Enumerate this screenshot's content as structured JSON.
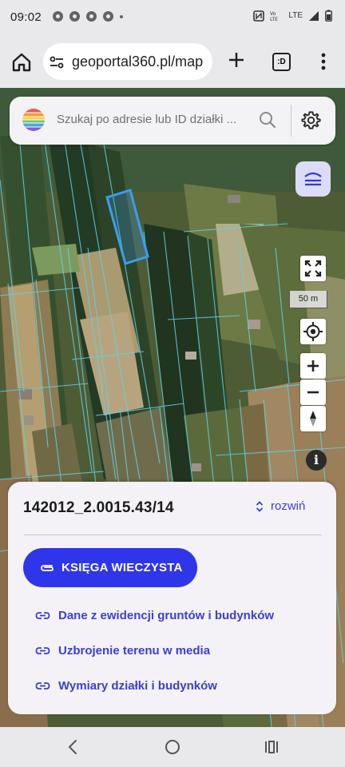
{
  "status": {
    "time": "09:02",
    "network": "LTE"
  },
  "browser": {
    "url": "geoportal360.pl/map",
    "tabs_label": ":D"
  },
  "search": {
    "placeholder": "Szukaj po adresie lub ID działki ..."
  },
  "map": {
    "scale_label": "50 m",
    "info_label": "i"
  },
  "panel": {
    "parcel_id": "142012_2.0015.43/14",
    "expand_label": "rozwiń",
    "primary_button": "KSIĘGA WIECZYSTA",
    "links": [
      "Dane z ewidencji gruntów i budynków",
      "Uzbrojenie terenu w media",
      "Wymiary działki i budynków"
    ]
  },
  "colors": {
    "accent": "#2f35e8",
    "link": "#3a3fd2",
    "parcel_outline": "#3d9cf0"
  }
}
